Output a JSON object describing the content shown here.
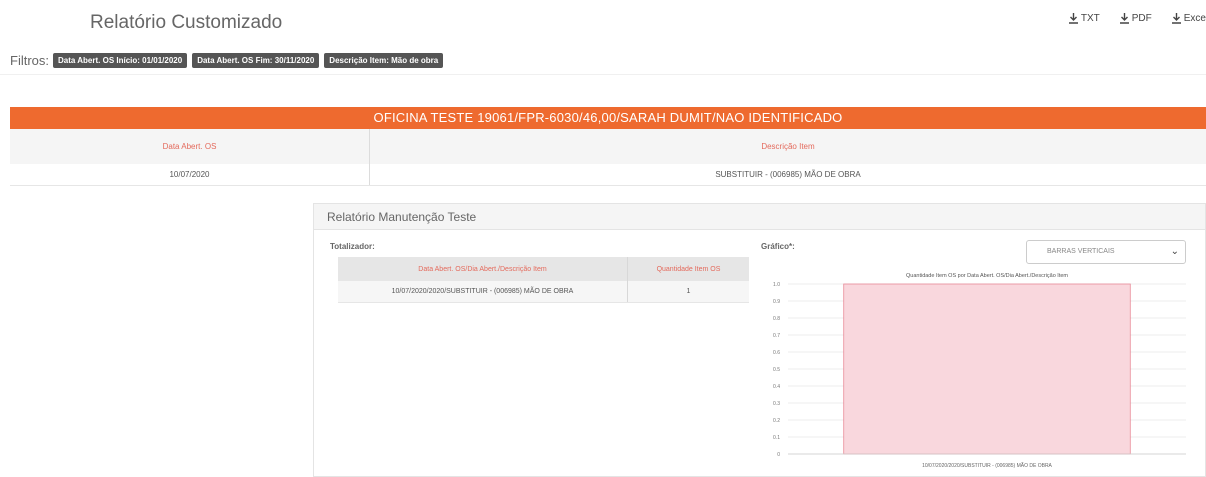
{
  "header": {
    "title": "Relatório Customizado",
    "exports": [
      {
        "label": "TXT",
        "icon": "download-icon"
      },
      {
        "label": "PDF",
        "icon": "download-icon"
      },
      {
        "label": "Exce",
        "icon": "download-icon"
      }
    ]
  },
  "filters": {
    "label": "Filtros:",
    "tags": [
      "Data Abert. OS Início: 01/01/2020",
      "Data Abert. OS Fim: 30/11/2020",
      "Descrição Item: Mão de obra"
    ]
  },
  "workshop": {
    "title": "OFICINA TESTE 19061/FPR-6030/46,00/SARAH DUMIT/NAO IDENTIFICADO",
    "columns": [
      "Data Abert. OS",
      "Descrição Item"
    ],
    "rows": [
      [
        "10/07/2020",
        "SUBSTITUIR - (006985) MÃO DE OBRA"
      ]
    ]
  },
  "report_panel": {
    "title": "Relatório Manutenção Teste",
    "totalizer": {
      "label": "Totalizador:",
      "columns": [
        "Data Abert. OS/Dia Abert./Descrição Item",
        "Quantidade Item OS"
      ],
      "rows": [
        [
          "10/07/2020/2020/SUBSTITUIR - (006985) MÃO DE OBRA",
          "1"
        ]
      ]
    },
    "chart_label": "Gráfico*:",
    "chart_select": "BARRAS VERTICAIS"
  },
  "colors": {
    "accent": "#ee6a2f",
    "header_text": "#e46a5c",
    "bar_fill": "#f9d7dd",
    "bar_stroke": "#e88a98"
  },
  "chart_data": {
    "type": "bar",
    "title": "Quantidade Item OS por Data Abert. OS/Dia Abert./Descrição Item",
    "categories": [
      "10/07/2020/2020/SUBSTITUIR - (006985) MÃO DE OBRA"
    ],
    "values": [
      1
    ],
    "ylim": [
      0,
      1
    ],
    "yticks": [
      "0",
      "0.1",
      "0.2",
      "0.3",
      "0.4",
      "0.5",
      "0.6",
      "0.7",
      "0.8",
      "0.9",
      "1.0"
    ],
    "grid": true
  }
}
